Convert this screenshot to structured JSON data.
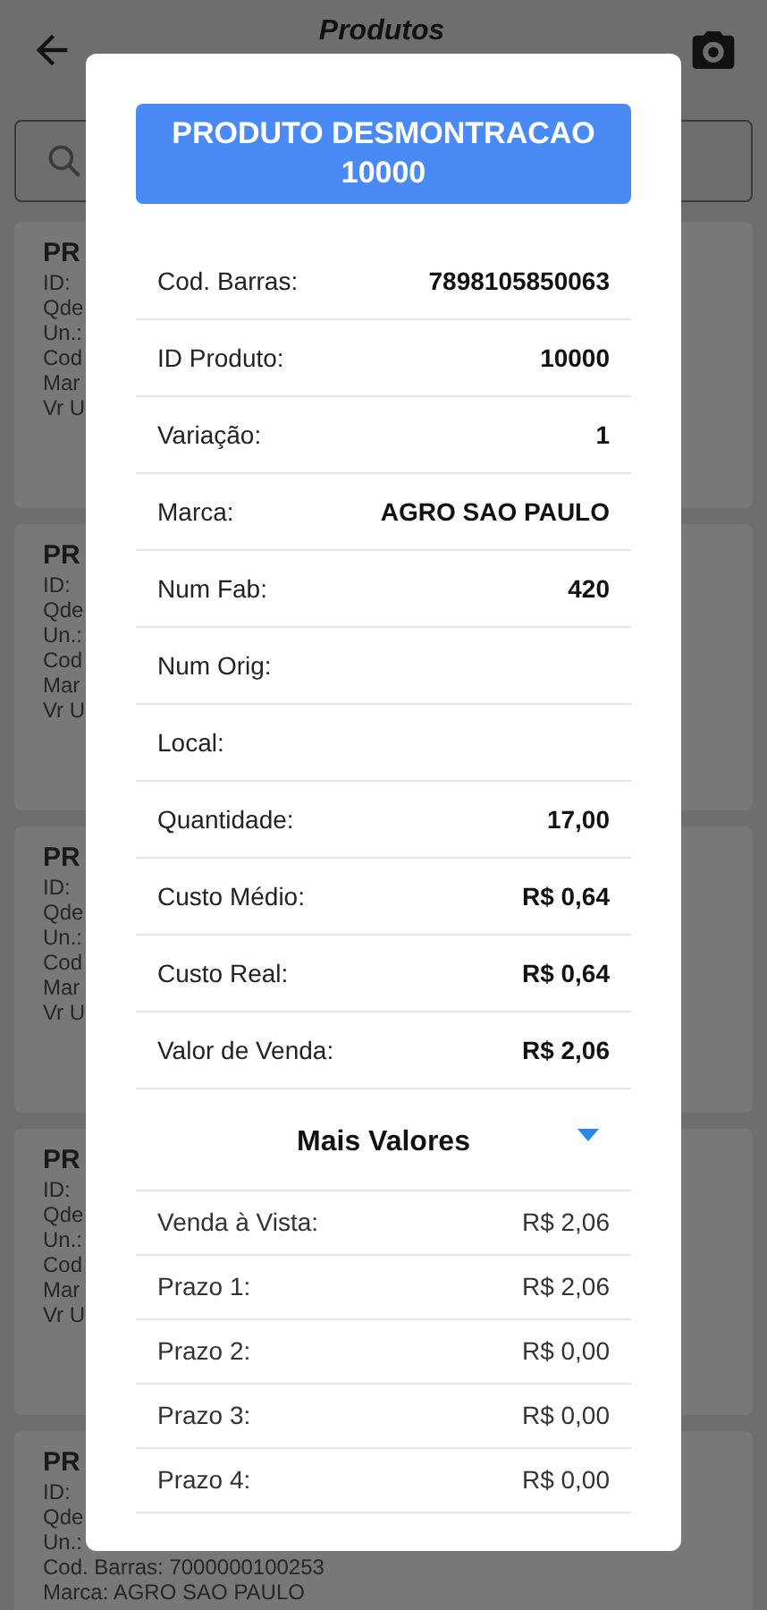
{
  "header": {
    "title": "Produtos"
  },
  "product_cards": [
    {
      "title": "PR",
      "lines": [
        "ID:",
        "Qde",
        "Un.:",
        "Cod",
        "Mar",
        "Vr U"
      ]
    },
    {
      "title": "PR",
      "lines": [
        "ID:",
        "Qde",
        "Un.:",
        "Cod",
        "Mar",
        "Vr U"
      ]
    },
    {
      "title": "PR",
      "lines": [
        "ID:",
        "Qde",
        "Un.:",
        "Cod",
        "Mar",
        "Vr U"
      ]
    },
    {
      "title": "PR",
      "lines": [
        "ID:",
        "Qde",
        "Un.:",
        "Cod",
        "Mar",
        "Vr U"
      ]
    },
    {
      "title": "PR",
      "lines": [
        "ID:",
        "Qde",
        "Un.:",
        "Cod. Barras: 7000000100253",
        "Marca: AGRO SAO PAULO"
      ]
    }
  ],
  "dialog": {
    "title": "PRODUTO DESMONTRACAO 10000",
    "fields": [
      {
        "label": "Cod. Barras:",
        "value": "7898105850063"
      },
      {
        "label": "ID Produto:",
        "value": "10000"
      },
      {
        "label": "Variação:",
        "value": "1"
      },
      {
        "label": "Marca:",
        "value": "AGRO SAO PAULO"
      },
      {
        "label": "Num Fab:",
        "value": "420"
      },
      {
        "label": "Num Orig:"
      },
      {
        "label": "Local:"
      },
      {
        "label": "Quantidade:",
        "value": "17,00"
      },
      {
        "label": "Custo Médio:",
        "value": "R$ 0,64"
      },
      {
        "label": "Custo Real:",
        "value": "R$ 0,64"
      },
      {
        "label": "Valor de Venda:",
        "value": "R$ 2,06"
      }
    ],
    "more_values": {
      "label": "Mais Valores",
      "expanded": true,
      "rows": [
        {
          "label": "Venda à Vista:",
          "value": "R$ 2,06"
        },
        {
          "label": "Prazo 1:",
          "value": "R$ 2,06"
        },
        {
          "label": "Prazo 2:",
          "value": "R$ 0,00"
        },
        {
          "label": "Prazo 3:",
          "value": "R$ 0,00"
        },
        {
          "label": "Prazo 4:",
          "value": "R$ 0,00"
        }
      ]
    }
  }
}
